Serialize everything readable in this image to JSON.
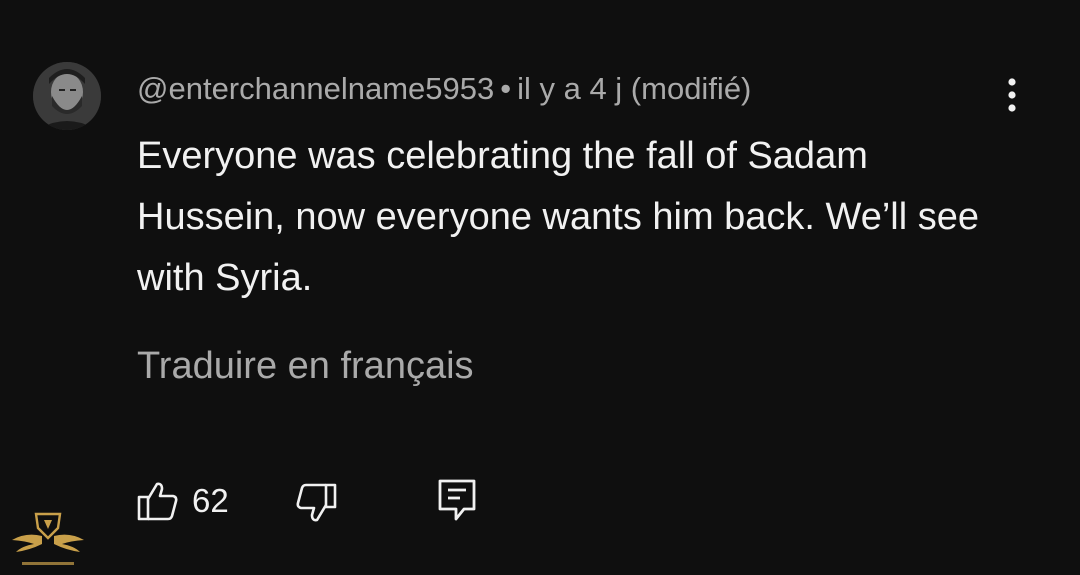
{
  "comment": {
    "author": "@enterchannelname5953",
    "separator": "•",
    "time": "il y a 4 j (modifié)",
    "text": "Everyone was celebrating the fall of Sadam Hussein, now everyone wants him back. We’ll see with Syria.",
    "translate_label": "Traduire en français",
    "like_count": "62"
  },
  "icons": {
    "menu": "vertical-dots-icon",
    "like": "thumbs-up-icon",
    "dislike": "thumbs-down-icon",
    "reply": "comment-reply-icon",
    "watermark": "winged-shield-logo"
  },
  "colors": {
    "background": "#0f0f0f",
    "primary_text": "#f1f1f1",
    "secondary_text": "#aaaaaa",
    "watermark_gold": "#c9a04a"
  }
}
